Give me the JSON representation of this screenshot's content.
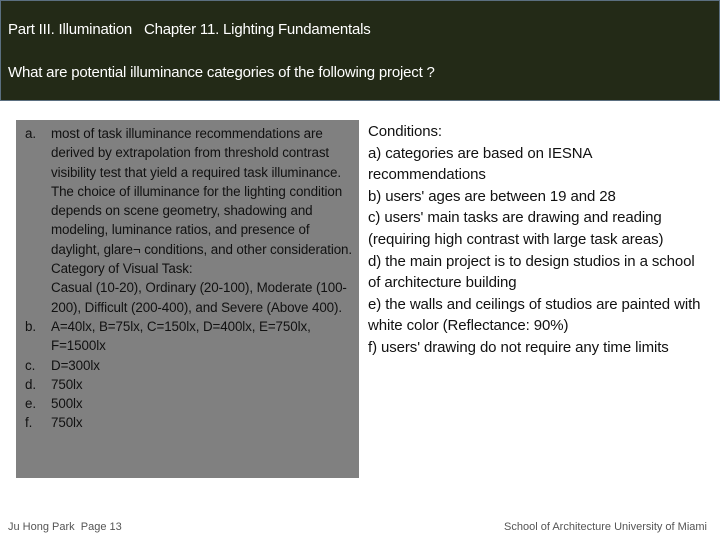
{
  "header": {
    "part": "Part III. Illumination",
    "chapter": "Chapter 11. Lighting Fundamentals",
    "question": "What are potential illuminance categories of the following project ?"
  },
  "options": [
    {
      "marker": "a.",
      "paragraphs": [
        "most of task illuminance recommendations are derived by extrapolation from threshold contrast visibility test that yield a required task illuminance. The choice of illuminance for the lighting condition depends on scene geometry, shadowing and modeling, luminance ratios, and presence of daylight, glare¬ conditions, and other consideration.",
        "Category of Visual Task:",
        "Casual (10-20), Ordinary (20-100), Moderate (100-200), Difficult (200-400), and Severe (Above 400)."
      ]
    },
    {
      "marker": "b.",
      "paragraphs": [
        "A=40lx, B=75lx, C=150lx, D=400lx, E=750lx, F=1500lx"
      ]
    },
    {
      "marker": "c.",
      "paragraphs": [
        "D=300lx"
      ]
    },
    {
      "marker": "d.",
      "paragraphs": [
        "750lx"
      ]
    },
    {
      "marker": "e.",
      "paragraphs": [
        "500lx"
      ]
    },
    {
      "marker": "f.",
      "paragraphs": [
        "750lx"
      ]
    }
  ],
  "conditions": {
    "heading": "Conditions:",
    "items": [
      "a) categories are based on IESNA recommendations",
      "b) users' ages are between 19 and 28",
      "c) users' main tasks are drawing and reading (requiring high contrast with large task areas)",
      "d) the main project is to design studios in a school of architecture building",
      "e) the walls and ceilings of studios are painted with white color (Reflectance: 90%)",
      "f) users' drawing do not require any time limits"
    ]
  },
  "footer": {
    "author": "Ju Hong Park",
    "page": "Page 13",
    "institution": "School of Architecture  University of Miami"
  },
  "colors": {
    "header_bg": "#232a17",
    "header_border": "#5b6f80",
    "options_bg": "#808080"
  }
}
